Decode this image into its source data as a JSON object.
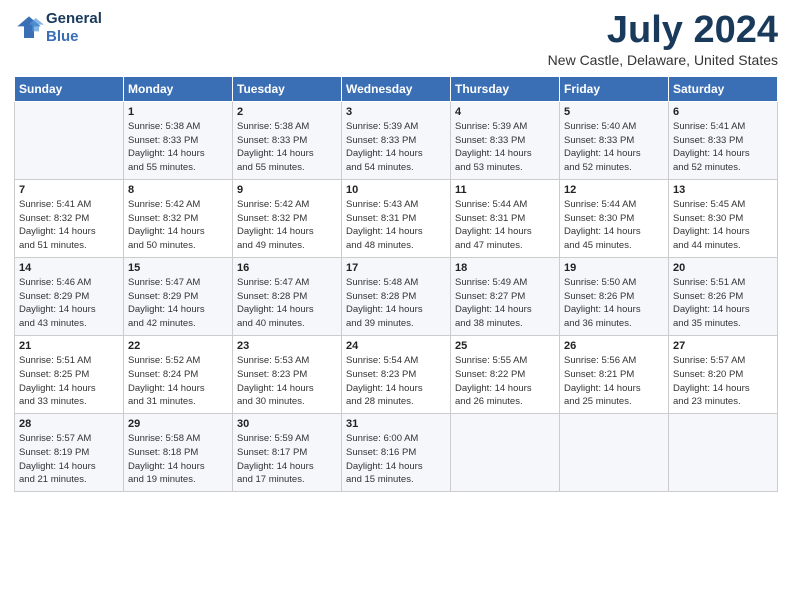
{
  "logo": {
    "line1": "General",
    "line2": "Blue"
  },
  "title": "July 2024",
  "subtitle": "New Castle, Delaware, United States",
  "header_days": [
    "Sunday",
    "Monday",
    "Tuesday",
    "Wednesday",
    "Thursday",
    "Friday",
    "Saturday"
  ],
  "weeks": [
    [
      {
        "day": "",
        "info": ""
      },
      {
        "day": "1",
        "info": "Sunrise: 5:38 AM\nSunset: 8:33 PM\nDaylight: 14 hours\nand 55 minutes."
      },
      {
        "day": "2",
        "info": "Sunrise: 5:38 AM\nSunset: 8:33 PM\nDaylight: 14 hours\nand 55 minutes."
      },
      {
        "day": "3",
        "info": "Sunrise: 5:39 AM\nSunset: 8:33 PM\nDaylight: 14 hours\nand 54 minutes."
      },
      {
        "day": "4",
        "info": "Sunrise: 5:39 AM\nSunset: 8:33 PM\nDaylight: 14 hours\nand 53 minutes."
      },
      {
        "day": "5",
        "info": "Sunrise: 5:40 AM\nSunset: 8:33 PM\nDaylight: 14 hours\nand 52 minutes."
      },
      {
        "day": "6",
        "info": "Sunrise: 5:41 AM\nSunset: 8:33 PM\nDaylight: 14 hours\nand 52 minutes."
      }
    ],
    [
      {
        "day": "7",
        "info": "Sunrise: 5:41 AM\nSunset: 8:32 PM\nDaylight: 14 hours\nand 51 minutes."
      },
      {
        "day": "8",
        "info": "Sunrise: 5:42 AM\nSunset: 8:32 PM\nDaylight: 14 hours\nand 50 minutes."
      },
      {
        "day": "9",
        "info": "Sunrise: 5:42 AM\nSunset: 8:32 PM\nDaylight: 14 hours\nand 49 minutes."
      },
      {
        "day": "10",
        "info": "Sunrise: 5:43 AM\nSunset: 8:31 PM\nDaylight: 14 hours\nand 48 minutes."
      },
      {
        "day": "11",
        "info": "Sunrise: 5:44 AM\nSunset: 8:31 PM\nDaylight: 14 hours\nand 47 minutes."
      },
      {
        "day": "12",
        "info": "Sunrise: 5:44 AM\nSunset: 8:30 PM\nDaylight: 14 hours\nand 45 minutes."
      },
      {
        "day": "13",
        "info": "Sunrise: 5:45 AM\nSunset: 8:30 PM\nDaylight: 14 hours\nand 44 minutes."
      }
    ],
    [
      {
        "day": "14",
        "info": "Sunrise: 5:46 AM\nSunset: 8:29 PM\nDaylight: 14 hours\nand 43 minutes."
      },
      {
        "day": "15",
        "info": "Sunrise: 5:47 AM\nSunset: 8:29 PM\nDaylight: 14 hours\nand 42 minutes."
      },
      {
        "day": "16",
        "info": "Sunrise: 5:47 AM\nSunset: 8:28 PM\nDaylight: 14 hours\nand 40 minutes."
      },
      {
        "day": "17",
        "info": "Sunrise: 5:48 AM\nSunset: 8:28 PM\nDaylight: 14 hours\nand 39 minutes."
      },
      {
        "day": "18",
        "info": "Sunrise: 5:49 AM\nSunset: 8:27 PM\nDaylight: 14 hours\nand 38 minutes."
      },
      {
        "day": "19",
        "info": "Sunrise: 5:50 AM\nSunset: 8:26 PM\nDaylight: 14 hours\nand 36 minutes."
      },
      {
        "day": "20",
        "info": "Sunrise: 5:51 AM\nSunset: 8:26 PM\nDaylight: 14 hours\nand 35 minutes."
      }
    ],
    [
      {
        "day": "21",
        "info": "Sunrise: 5:51 AM\nSunset: 8:25 PM\nDaylight: 14 hours\nand 33 minutes."
      },
      {
        "day": "22",
        "info": "Sunrise: 5:52 AM\nSunset: 8:24 PM\nDaylight: 14 hours\nand 31 minutes."
      },
      {
        "day": "23",
        "info": "Sunrise: 5:53 AM\nSunset: 8:23 PM\nDaylight: 14 hours\nand 30 minutes."
      },
      {
        "day": "24",
        "info": "Sunrise: 5:54 AM\nSunset: 8:23 PM\nDaylight: 14 hours\nand 28 minutes."
      },
      {
        "day": "25",
        "info": "Sunrise: 5:55 AM\nSunset: 8:22 PM\nDaylight: 14 hours\nand 26 minutes."
      },
      {
        "day": "26",
        "info": "Sunrise: 5:56 AM\nSunset: 8:21 PM\nDaylight: 14 hours\nand 25 minutes."
      },
      {
        "day": "27",
        "info": "Sunrise: 5:57 AM\nSunset: 8:20 PM\nDaylight: 14 hours\nand 23 minutes."
      }
    ],
    [
      {
        "day": "28",
        "info": "Sunrise: 5:57 AM\nSunset: 8:19 PM\nDaylight: 14 hours\nand 21 minutes."
      },
      {
        "day": "29",
        "info": "Sunrise: 5:58 AM\nSunset: 8:18 PM\nDaylight: 14 hours\nand 19 minutes."
      },
      {
        "day": "30",
        "info": "Sunrise: 5:59 AM\nSunset: 8:17 PM\nDaylight: 14 hours\nand 17 minutes."
      },
      {
        "day": "31",
        "info": "Sunrise: 6:00 AM\nSunset: 8:16 PM\nDaylight: 14 hours\nand 15 minutes."
      },
      {
        "day": "",
        "info": ""
      },
      {
        "day": "",
        "info": ""
      },
      {
        "day": "",
        "info": ""
      }
    ]
  ]
}
